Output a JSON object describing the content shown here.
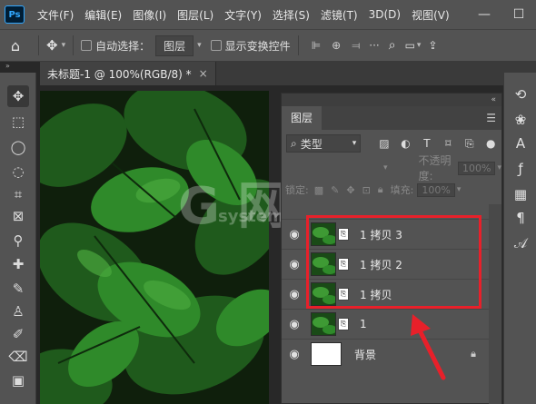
{
  "app": {
    "logo": "Ps"
  },
  "menu": [
    "文件(F)",
    "编辑(E)",
    "图像(I)",
    "图层(L)",
    "文字(Y)",
    "选择(S)",
    "滤镜(T)",
    "3D(D)",
    "视图(V)"
  ],
  "window_controls": {
    "minimize": "—",
    "maximize": "☐",
    "close": "✕"
  },
  "options": {
    "auto_select_label": "自动选择：",
    "auto_select_value": "图层",
    "show_transform_label": "显示变换控件"
  },
  "document_tab": {
    "title": "未标题-1 @ 100%(RGB/8) *",
    "close": "×"
  },
  "panel": {
    "tab_label": "图层",
    "filter_kind": "类型",
    "opacity_label": "不透明度:",
    "opacity_value": "100%",
    "lock_label": "锁定:",
    "fill_label": "填充:",
    "fill_value": "100%"
  },
  "layers": [
    {
      "name": "1 拷贝 3",
      "kind": "smart-object",
      "visible": true
    },
    {
      "name": "1 拷贝 2",
      "kind": "smart-object",
      "visible": true
    },
    {
      "name": "1 拷贝",
      "kind": "smart-object",
      "visible": true
    },
    {
      "name": "1",
      "kind": "image",
      "visible": true
    },
    {
      "name": "背景",
      "kind": "background",
      "visible": true,
      "locked": true
    }
  ],
  "watermark": {
    "main": "G 网",
    "sub": "system.com"
  },
  "colors": {
    "highlight": "#e8202a",
    "panel_bg": "#535353",
    "app_bg": "#282828"
  }
}
